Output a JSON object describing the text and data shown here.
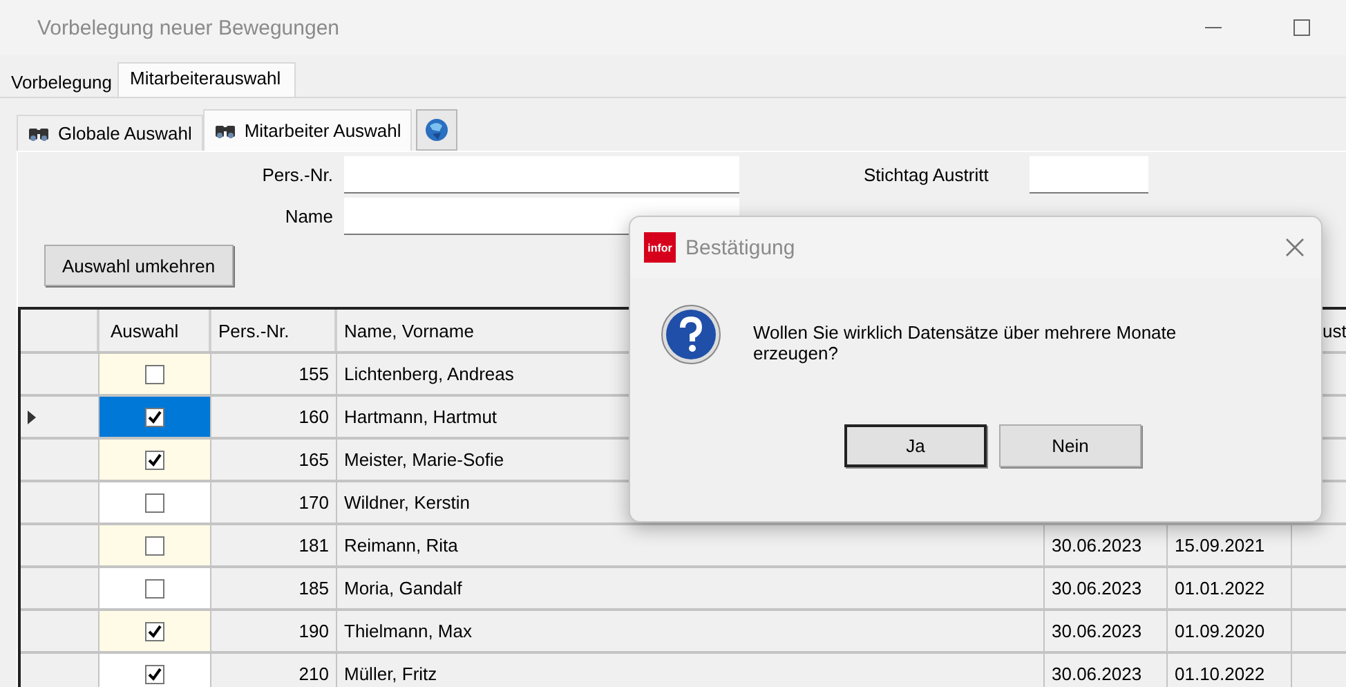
{
  "window": {
    "title": "Vorbelegung neuer Bewegungen"
  },
  "tabs": [
    {
      "label": "Vorbelegung",
      "selected": false
    },
    {
      "label": "Mitarbeiterauswahl",
      "selected": true
    }
  ],
  "subtabs": [
    {
      "label": "Globale Auswahl",
      "selected": false
    },
    {
      "label": "Mitarbeiter Auswahl",
      "selected": true
    }
  ],
  "filters": {
    "pers_nr": "Pers.-Nr.",
    "name": "Name",
    "stichtag": "Stichtag Austritt"
  },
  "invert_button": "Auswahl umkehren",
  "table": {
    "columns": [
      "Auswahl",
      "Pers.-Nr.",
      "Name, Vorname",
      null,
      null,
      "ust"
    ],
    "rows": [
      {
        "checked": false,
        "selected": false,
        "pers_nr": "155",
        "name": "Lichtenberg, Andreas"
      },
      {
        "checked": true,
        "selected": true,
        "pers_nr": "160",
        "name": "Hartmann, Hartmut"
      },
      {
        "checked": true,
        "selected": false,
        "pers_nr": "165",
        "name": "Meister, Marie-Sofie"
      },
      {
        "checked": false,
        "selected": false,
        "pers_nr": "170",
        "name": "Wildner, Kerstin"
      },
      {
        "checked": false,
        "selected": false,
        "pers_nr": "181",
        "name": "Reimann, Rita",
        "column_5": "30.06.2023",
        "column_6": "15.09.2021"
      },
      {
        "checked": false,
        "selected": false,
        "pers_nr": "185",
        "name": "Moria, Gandalf",
        "column_5": "30.06.2023",
        "column_6": "01.01.2022"
      },
      {
        "checked": true,
        "selected": false,
        "pers_nr": "190",
        "name": "Thielmann, Max",
        "column_5": "30.06.2023",
        "column_6": "01.09.2020"
      },
      {
        "checked": true,
        "selected": false,
        "pers_nr": "210",
        "name": "Müller, Fritz",
        "column_5": "30.06.2023",
        "column_6": "01.10.2022"
      }
    ]
  },
  "dialog": {
    "logo": "infor",
    "title": "Bestätigung",
    "message": "Wollen Sie wirklich Datensätze über mehrere Monate erzeugen?",
    "buttons": [
      {
        "label": "Ja",
        "default": true
      },
      {
        "label": "Nein",
        "default": false
      }
    ]
  }
}
